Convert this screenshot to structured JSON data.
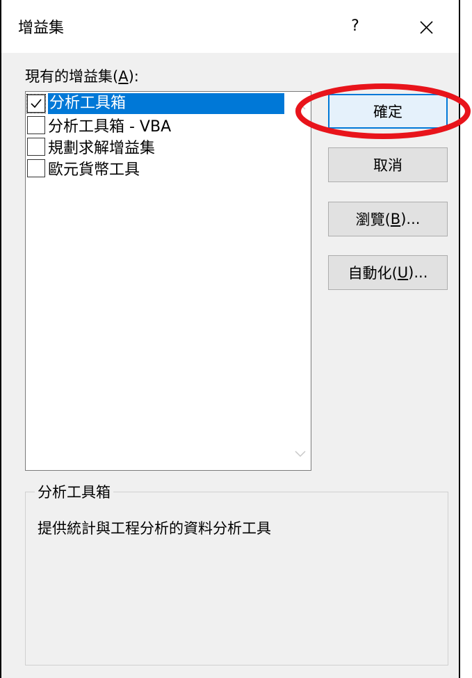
{
  "window": {
    "title": "增益集",
    "help_label": "?",
    "close_label": "✕"
  },
  "addins": {
    "caption_prefix": "現有的增益集(",
    "caption_accel": "A",
    "caption_suffix": "):",
    "items": [
      {
        "label": "分析工具箱",
        "checked": true,
        "selected": true
      },
      {
        "label": "分析工具箱 - VBA",
        "checked": false,
        "selected": false
      },
      {
        "label": "規劃求解增益集",
        "checked": false,
        "selected": false
      },
      {
        "label": "歐元貨幣工具",
        "checked": false,
        "selected": false
      }
    ]
  },
  "buttons": {
    "ok": "確定",
    "cancel": "取消",
    "browse_prefix": "瀏覽(",
    "browse_accel": "B",
    "browse_suffix": ")...",
    "auto_prefix": "自動化(",
    "auto_accel": "U",
    "auto_suffix": ")..."
  },
  "details": {
    "group_title": "分析工具箱",
    "description": "提供統計與工程分析的資料分析工具"
  },
  "colors": {
    "selection": "#0078d7",
    "highlight_annotation": "#e8141b"
  }
}
